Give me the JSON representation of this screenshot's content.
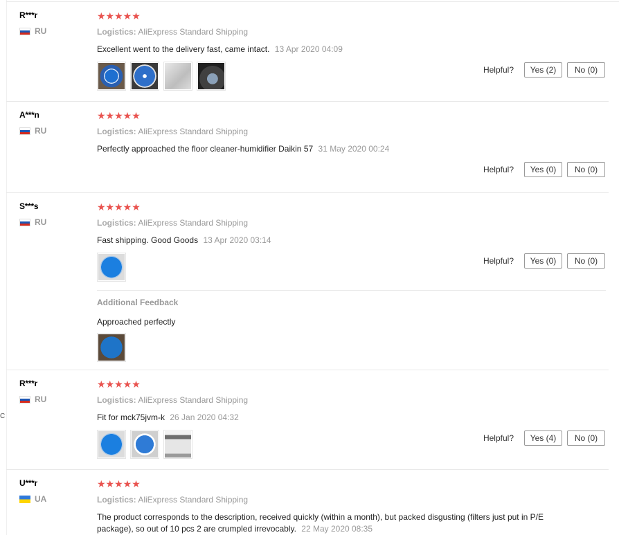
{
  "side_label": "C",
  "reviews": [
    {
      "name": "R***r",
      "country": "RU",
      "stars": "★★★★★",
      "ship_label": "Logistics:",
      "ship_value": "AliExpress Standard Shipping",
      "text": "Excellent went to the delivery fast, came intact.",
      "date": "13 Apr 2020 04:09",
      "helpful_label": "Helpful?",
      "yes": "Yes (2)",
      "no": "No (0)"
    },
    {
      "name": "A***n",
      "country": "RU",
      "stars": "★★★★★",
      "ship_label": "Logistics:",
      "ship_value": "AliExpress Standard Shipping",
      "text": "Perfectly approached the floor cleaner-humidifier Daikin 57",
      "date": "31 May 2020 00:24",
      "helpful_label": "Helpful?",
      "yes": "Yes (0)",
      "no": "No (0)"
    },
    {
      "name": "S***s",
      "country": "RU",
      "stars": "★★★★★",
      "ship_label": "Logistics:",
      "ship_value": "AliExpress Standard Shipping",
      "text": "Fast shipping. Good Goods",
      "date": "13 Apr 2020 03:14",
      "helpful_label": "Helpful?",
      "yes": "Yes (0)",
      "no": "No (0)",
      "additional_title": "Additional Feedback",
      "additional_text": "Approached perfectly"
    },
    {
      "name": "R***r",
      "country": "RU",
      "stars": "★★★★★",
      "ship_label": "Logistics:",
      "ship_value": "AliExpress Standard Shipping",
      "text": "Fit for mck75jvm-k",
      "date": "26 Jan 2020 04:32",
      "helpful_label": "Helpful?",
      "yes": "Yes (4)",
      "no": "No (0)"
    },
    {
      "name": "U***r",
      "country": "UA",
      "stars": "★★★★★",
      "ship_label": "Logistics:",
      "ship_value": "AliExpress Standard Shipping",
      "text": "The product corresponds to the description, received quickly (within a month), but packed disgusting (filters just put in P/E package), so out of 10 pcs 2 are crumpled irrevocably.",
      "date": "22 May 2020 08:35"
    }
  ]
}
